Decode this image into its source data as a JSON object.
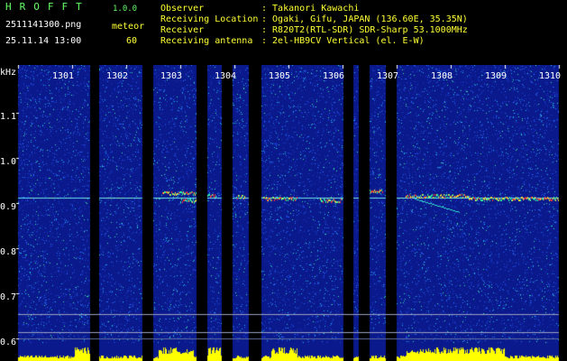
{
  "header": {
    "app_name": "HROFFT",
    "version": "1.0.0",
    "filename": "2511141300.png",
    "datetime": "25.11.14 13:00",
    "meteor_label": "meteor",
    "meteor_count": "60",
    "fields": [
      {
        "label": "Observer",
        "value": ": Takanori Kawachi"
      },
      {
        "label": "Receiving Location",
        "value": ": Ogaki, Gifu, JAPAN (136.60E, 35.35N)"
      },
      {
        "label": "Receiver",
        "value": ": R820T2(RTL-SDR) SDR-Sharp 53.1000MHz"
      },
      {
        "label": "Receiving antenna",
        "value": ": 2el-HB9CV Vertical (el. E-W)"
      }
    ]
  },
  "y_axis": {
    "unit": "kHz",
    "ticks": [
      "1.1",
      "1.0",
      "0.9",
      "0.8",
      "0.7",
      "0.6"
    ]
  },
  "minute_ticks": [
    "1301",
    "1302",
    "1303",
    "1304",
    "1305",
    "1306",
    "1307",
    "1308",
    "1309",
    "1310"
  ],
  "colors": {
    "background": "#000000",
    "spectrogram_base": "#0a1a8c",
    "echo": "#ff3333",
    "noise_bars": "#ffff00",
    "label_green": "#66ff66",
    "label_yellow": "#ffff33"
  }
}
